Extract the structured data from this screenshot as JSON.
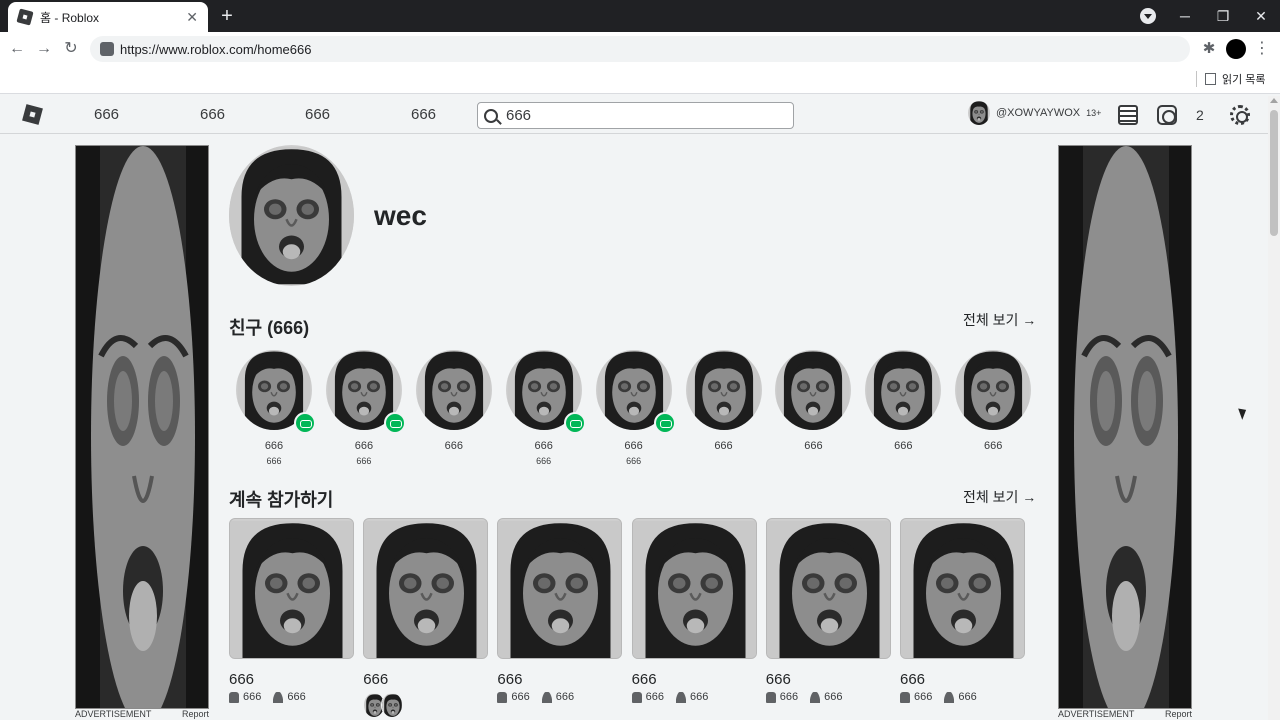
{
  "browser": {
    "tab_title": "홈 - Roblox",
    "tab_close": "✕",
    "new_tab": "+",
    "url": "https://www.roblox.com/home666",
    "reading_list": "읽기 목록",
    "window_controls": [
      "─",
      "❐",
      "✕"
    ]
  },
  "nav": {
    "links": [
      "666",
      "666",
      "666",
      "666"
    ],
    "search_value": "666",
    "username": "@XOWYAYWOX",
    "age_badge": "13+",
    "robux": "2"
  },
  "profile": {
    "display_name": "wec"
  },
  "friends": {
    "title": "친구 (666)",
    "see_all": "전체 보기 →",
    "items": [
      {
        "name": "666",
        "status": "666",
        "in_game": true
      },
      {
        "name": "666",
        "status": "666",
        "in_game": true
      },
      {
        "name": "666",
        "status": "",
        "in_game": false
      },
      {
        "name": "666",
        "status": "666",
        "in_game": true
      },
      {
        "name": "666",
        "status": "666",
        "in_game": true
      },
      {
        "name": "666",
        "status": "",
        "in_game": false
      },
      {
        "name": "666",
        "status": "",
        "in_game": false
      },
      {
        "name": "666",
        "status": "",
        "in_game": false
      },
      {
        "name": "666",
        "status": "",
        "in_game": false
      }
    ]
  },
  "continue": {
    "title": "계속 참가하기",
    "see_all": "전체 보기 →",
    "games": [
      {
        "name": "666",
        "likes": "666",
        "players": "666",
        "friends": false
      },
      {
        "name": "666",
        "likes": "",
        "players": "",
        "friends": true
      },
      {
        "name": "666",
        "likes": "666",
        "players": "666",
        "friends": false
      },
      {
        "name": "666",
        "likes": "666",
        "players": "666",
        "friends": false
      },
      {
        "name": "666",
        "likes": "666",
        "players": "666",
        "friends": false
      },
      {
        "name": "666",
        "likes": "666",
        "players": "666",
        "friends": false
      }
    ]
  },
  "ads": {
    "label": "ADVERTISEMENT",
    "report": "Report"
  },
  "colors": {
    "accent_green": "#02b757",
    "page_bg": "#f2f4f5",
    "text": "#393b3d"
  }
}
